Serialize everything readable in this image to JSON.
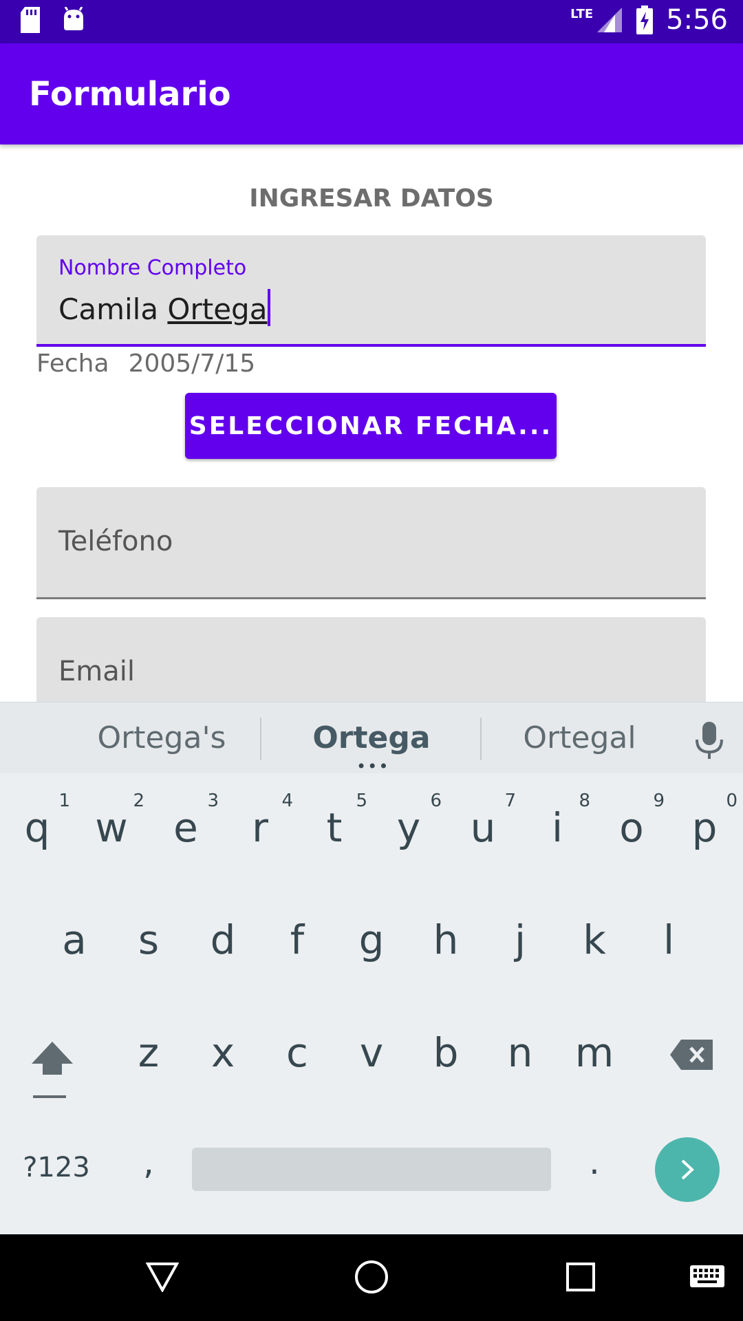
{
  "status_bar": {
    "time": "5:56",
    "network": "LTE"
  },
  "app_bar": {
    "title": "Formulario"
  },
  "form": {
    "section_title": "INGRESAR DATOS",
    "name": {
      "label": "Nombre Completo",
      "value_first": "Camila ",
      "value_last": "Ortega"
    },
    "date": {
      "label": "Fecha",
      "value": "2005/7/15"
    },
    "date_button": "SELECCIONAR FECHA...",
    "phone": {
      "placeholder": "Teléfono"
    },
    "email": {
      "placeholder": "Email"
    }
  },
  "keyboard": {
    "suggestions": [
      "Ortega's",
      "Ortega",
      "Ortegal"
    ],
    "row1": [
      "q",
      "w",
      "e",
      "r",
      "t",
      "y",
      "u",
      "i",
      "o",
      "p"
    ],
    "row1_hints": [
      "1",
      "2",
      "3",
      "4",
      "5",
      "6",
      "7",
      "8",
      "9",
      "0"
    ],
    "row2": [
      "a",
      "s",
      "d",
      "f",
      "g",
      "h",
      "j",
      "k",
      "l"
    ],
    "row3": [
      "z",
      "x",
      "c",
      "v",
      "b",
      "n",
      "m"
    ],
    "symbols_key": "?123",
    "comma_key": ",",
    "period_key": "."
  },
  "colors": {
    "primary": "#6200ee",
    "status_bar": "#3a00b0",
    "enter_key": "#4db6ac"
  }
}
